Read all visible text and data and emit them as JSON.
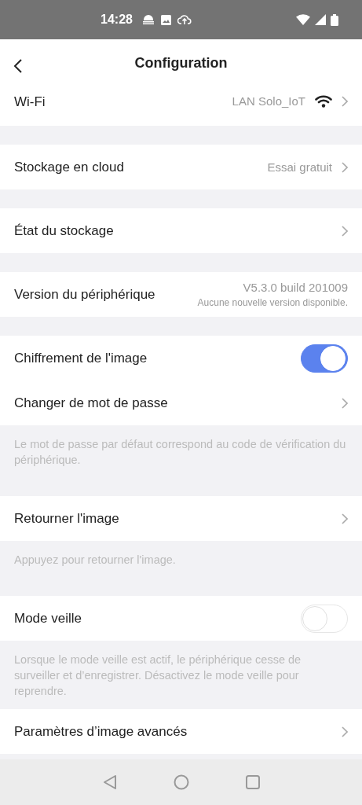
{
  "status_bar": {
    "time": "14:28"
  },
  "header": {
    "title": "Configuration"
  },
  "groups": [
    {
      "rows": [
        {
          "kind": "network",
          "label": "Wi-Fi",
          "value": "LAN Solo_IoT"
        }
      ]
    },
    {
      "rows": [
        {
          "kind": "link",
          "label": "Stockage en cloud",
          "value": "Essai gratuit"
        }
      ]
    },
    {
      "rows": [
        {
          "kind": "link",
          "label": "État du stockage"
        }
      ]
    },
    {
      "rows": [
        {
          "kind": "version",
          "label": "Version du périphérique",
          "value": "V5.3.0 build 201009",
          "subvalue": "Aucune nouvelle version disponible."
        }
      ]
    },
    {
      "rows": [
        {
          "kind": "toggle",
          "label": "Chiffrement de l'image",
          "on": true
        },
        {
          "kind": "link",
          "label": "Changer de mot de passe"
        }
      ],
      "note": "Le mot de passe par défaut correspond au code de vérification du périphérique."
    },
    {
      "rows": [
        {
          "kind": "link",
          "label": "Retourner l'image"
        }
      ],
      "note": "Appuyez pour retourner l'image."
    },
    {
      "rows": [
        {
          "kind": "toggle",
          "label": "Mode veille",
          "on": false
        }
      ],
      "note": "Lorsque le mode veille est actif, le périphérique cesse de surveiller et d’enregistrer. Désactivez le mode veille pour reprendre."
    },
    {
      "rows": [
        {
          "kind": "link",
          "label": "Paramètres d’image avancés"
        }
      ]
    }
  ]
}
